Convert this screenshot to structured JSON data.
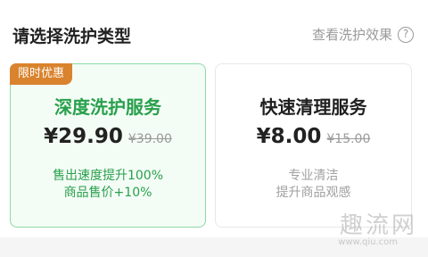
{
  "header": {
    "title": "请选择洗护类型",
    "effect_link_label": "查看洗护效果",
    "help_symbol": "?"
  },
  "cards": {
    "deep": {
      "badge": "限时优惠",
      "name": "深度洗护服务",
      "price": "¥29.90",
      "old_price": "¥39.00",
      "desc_line1": "售出速度提升100%",
      "desc_line2": "商品售价+10%",
      "selected": true
    },
    "fast": {
      "name": "快速清理服务",
      "price": "¥8.00",
      "old_price": "¥15.00",
      "desc_line1": "专业清洁",
      "desc_line2": "提升商品观感",
      "selected": false
    }
  },
  "watermark": {
    "text": "趣流网",
    "url": "www.qiu.com"
  },
  "colors": {
    "accent_green": "#28a04b",
    "badge_orange": "#d9832e",
    "selected_border": "#8ed9a6"
  },
  "icons": {
    "help": "question-circle-icon"
  }
}
